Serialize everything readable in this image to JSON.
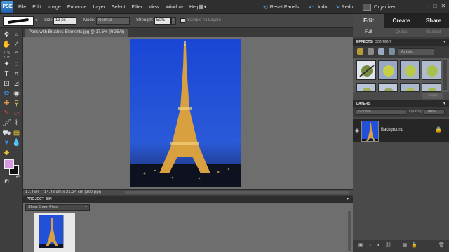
{
  "app": {
    "logo_text": "PSE"
  },
  "menu": {
    "items": [
      "File",
      "Edit",
      "Image",
      "Enhance",
      "Layer",
      "Select",
      "Filter",
      "View",
      "Window",
      "Help"
    ],
    "reset_panels": "Reset Panels",
    "undo": "Undo",
    "redo": "Redo",
    "organizer": "Organizer"
  },
  "options": {
    "size_label": "Size:",
    "size_value": "13 px",
    "mode_label": "Mode:",
    "mode_value": "Normal",
    "strength_label": "Strength:",
    "strength_value": "50%",
    "sample_all_layers": "Sample All Layers"
  },
  "document": {
    "tab_title": "Paris with Brushes Elements.jpg @ 17.6% (RGB/8)",
    "zoom": "17.46%",
    "info": "14.43 cm x 21.24 cm (300 ppi)"
  },
  "project_bin": {
    "title": "PROJECT BIN",
    "show": "Show Open Files"
  },
  "mode_tabs": [
    "Edit",
    "Create",
    "Share"
  ],
  "edit_subtabs": [
    "Full",
    "Quick",
    "Guided"
  ],
  "effects": {
    "tabs": [
      "EFFECTS",
      "CONTENT"
    ],
    "category": "Artistic",
    "apply": "Apply"
  },
  "layers": {
    "title": "LAYERS",
    "blend_mode": "Normal",
    "opacity_label": "Opacity:",
    "opacity_value": "100%",
    "items": [
      {
        "name": "Background"
      }
    ]
  },
  "colors": {
    "foreground": "#d59ae0",
    "background": "#111111",
    "accent": "#5aa0e0"
  }
}
